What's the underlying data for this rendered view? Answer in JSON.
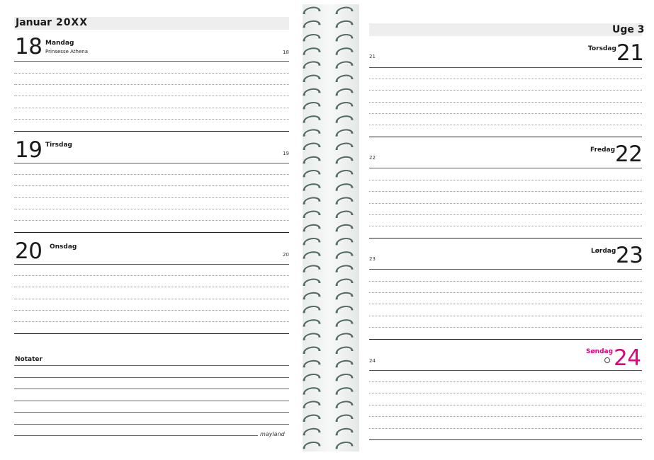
{
  "left_page": {
    "month": "Januar",
    "year": "20XX",
    "days": [
      {
        "number": "18",
        "name": "Mandag",
        "note": "Prinsesse Athena",
        "small": "18"
      },
      {
        "number": "19",
        "name": "Tirsdag",
        "note": "",
        "small": "19"
      },
      {
        "number": "20",
        "name": "Onsdag",
        "note": "",
        "small": "20"
      }
    ],
    "notes_label": "Notater",
    "brand": "mayland"
  },
  "right_page": {
    "week": "Uge 3",
    "days": [
      {
        "number": "21",
        "name": "Torsdag",
        "small": "21"
      },
      {
        "number": "22",
        "name": "Fredag",
        "small": "22"
      },
      {
        "number": "23",
        "name": "Lørdag",
        "small": "23"
      },
      {
        "number": "24",
        "name": "Søndag",
        "small": "24"
      }
    ]
  },
  "colors": {
    "sunday": "#e4007f",
    "header_band": "#eeeeee"
  }
}
